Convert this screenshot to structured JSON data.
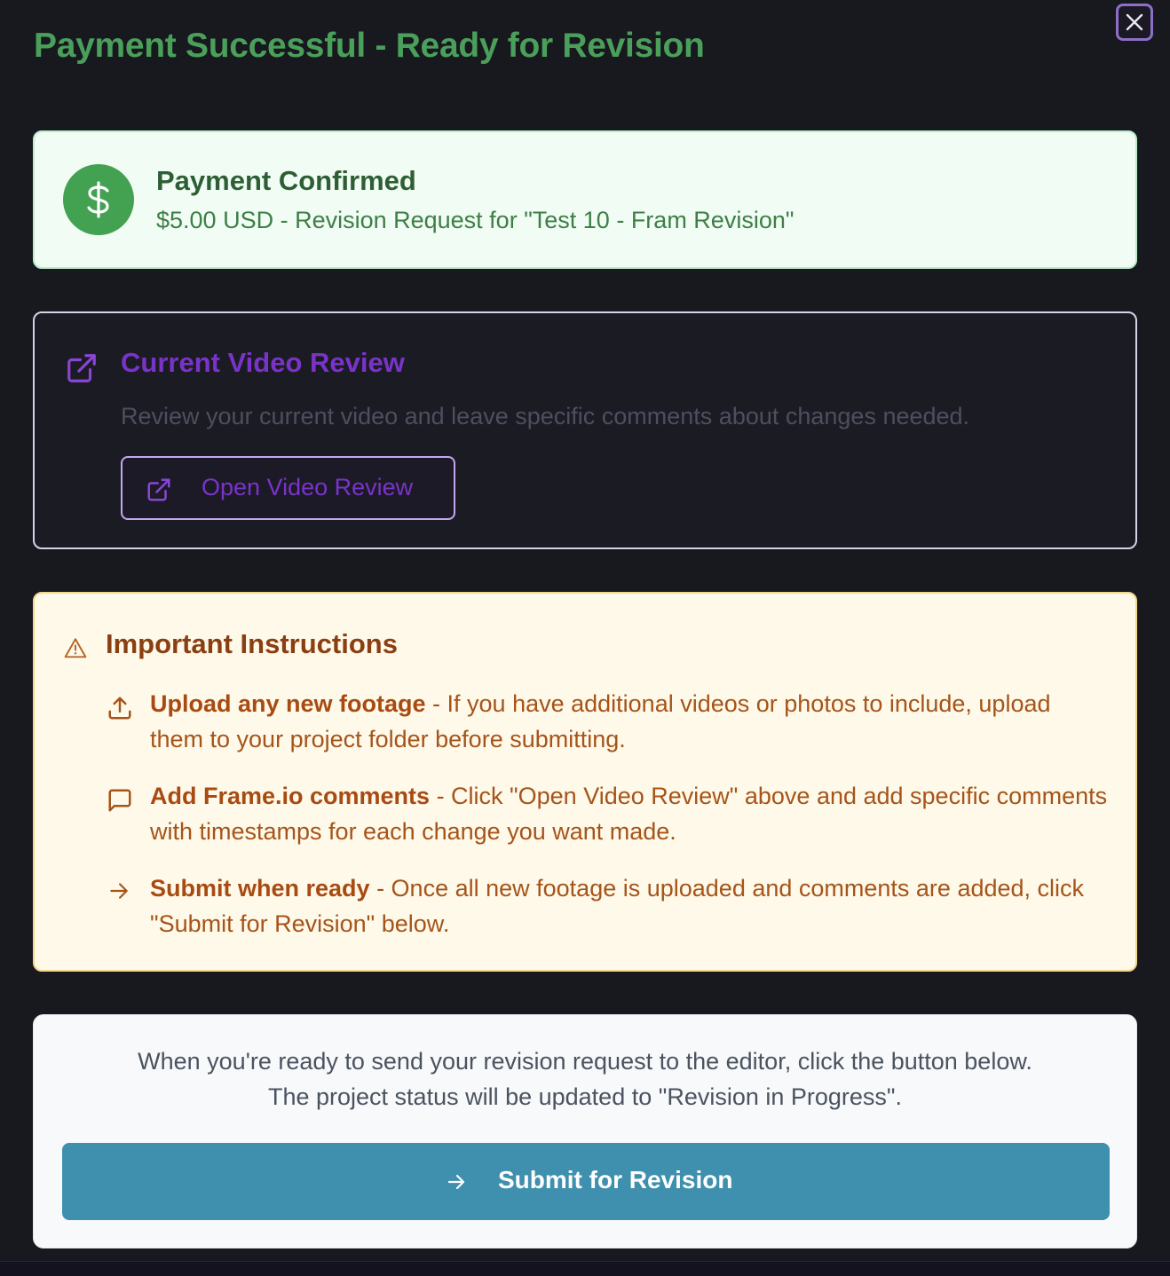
{
  "dialog": {
    "title": "Payment Successful - Ready for Revision"
  },
  "payment": {
    "icon": "dollar-icon",
    "title": "Payment Confirmed",
    "subtitle": "$5.00 USD - Revision Request for \"Test 10 - Fram Revision\""
  },
  "video_review": {
    "icon": "external-link-icon",
    "title": "Current Video Review",
    "description": "Review your current video and leave specific comments about changes needed.",
    "button_label": "Open Video Review"
  },
  "instructions": {
    "icon": "warning-icon",
    "title": "Important Instructions",
    "items": [
      {
        "icon": "upload-icon",
        "bold": "Upload any new footage",
        "text": " - If you have additional videos or photos to include, upload them to your project folder before submitting."
      },
      {
        "icon": "comment-icon",
        "bold": "Add Frame.io comments",
        "text": " - Click \"Open Video Review\" above and add specific comments with timestamps for each change you want made."
      },
      {
        "icon": "arrow-right-icon",
        "bold": "Submit when ready",
        "text": " - Once all new footage is uploaded and comments are added, click \"Submit for Revision\" below."
      }
    ]
  },
  "submit": {
    "line1": "When you're ready to send your revision request to the editor, click the button below.",
    "line2": "The project status will be updated to \"Revision in Progress\".",
    "button_label": "Submit for Revision"
  },
  "colors": {
    "background": "#18181f",
    "success_title": "#4a9f5a",
    "payment_card_bg": "#f0fcf4",
    "accent_purple": "#7a33c9",
    "instructions_bg": "#fff9e9",
    "instructions_text": "#a5541a",
    "submit_button": "#3f8fae"
  }
}
